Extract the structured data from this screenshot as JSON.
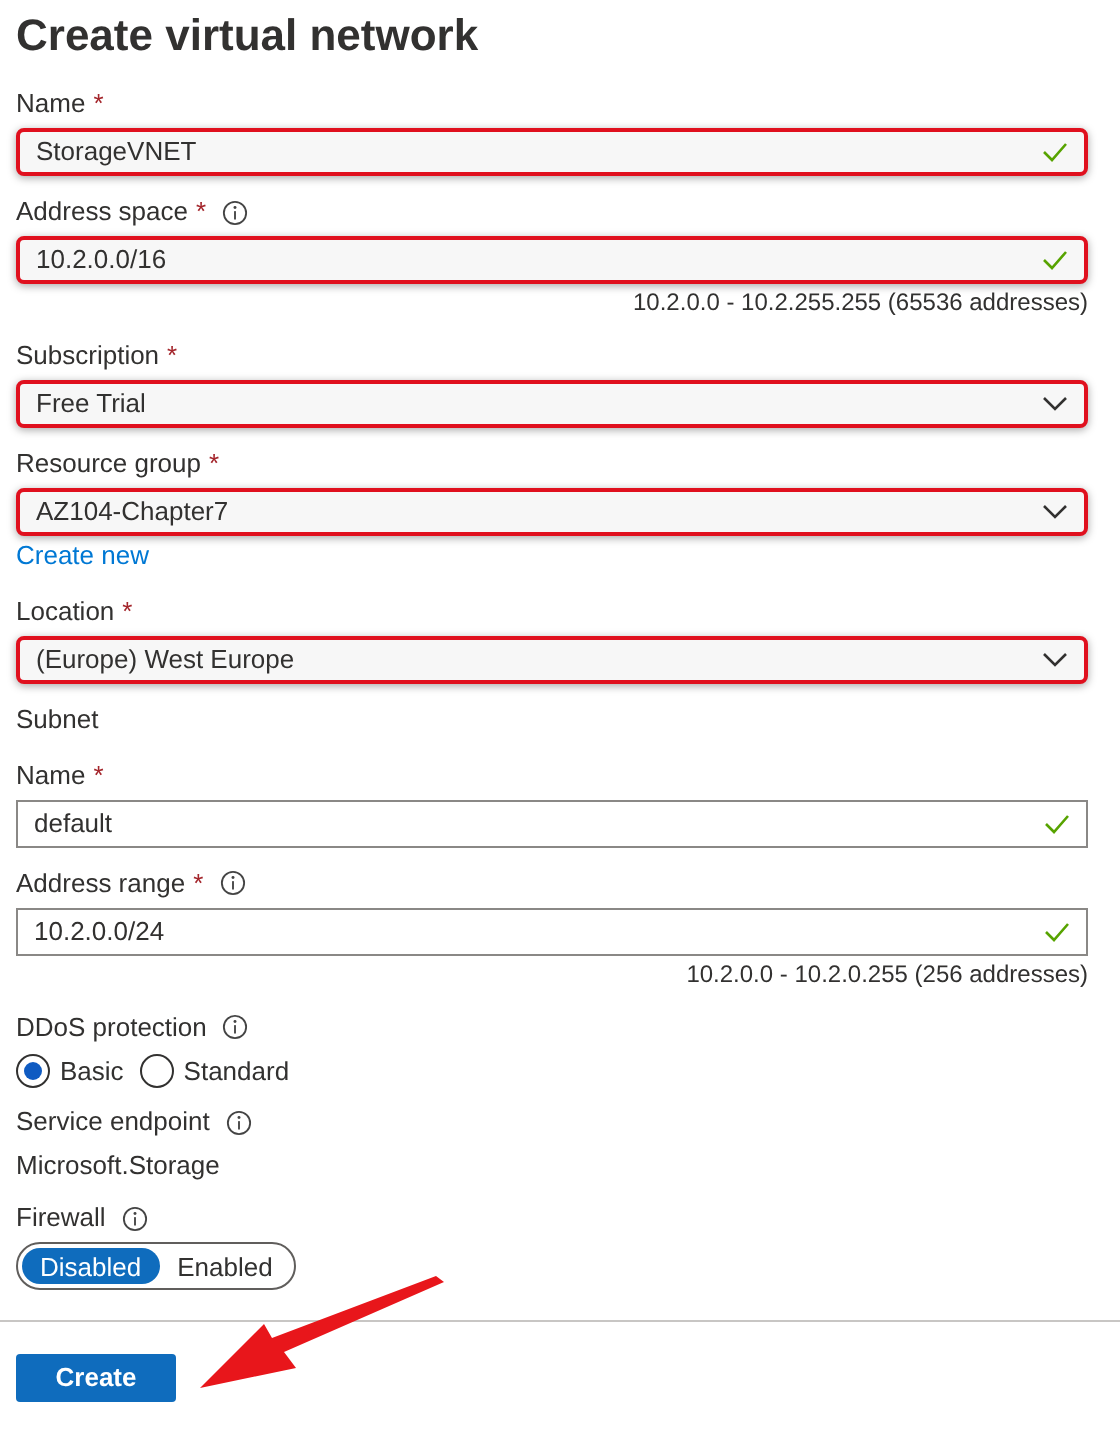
{
  "title": "Create virtual network",
  "form": [
    {
      "kind": "field",
      "label": "Name",
      "asterisk": "*",
      "value": "StorageVNET",
      "highlighted": true,
      "valid": true
    },
    {
      "kind": "field",
      "label": "Address space",
      "asterisk": "*",
      "info": true,
      "value": "10.2.0.0/16",
      "highlighted": true,
      "valid": true,
      "hint": "10.2.0.0 - 10.2.255.255 (65536 addresses)"
    },
    {
      "kind": "select",
      "label": "Subscription",
      "asterisk": "*",
      "value": "Free Trial",
      "highlighted": true
    },
    {
      "kind": "select",
      "label": "Resource group",
      "asterisk": "*",
      "value": "AZ104-Chapter7",
      "highlighted": true,
      "link": "Create new"
    },
    {
      "kind": "select",
      "label": "Location",
      "asterisk": "*",
      "value": "(Europe) West Europe",
      "highlighted": true
    },
    {
      "kind": "heading",
      "label": "Subnet"
    },
    {
      "kind": "field",
      "label": "Name",
      "asterisk": "*",
      "value": "default",
      "highlighted": false,
      "valid": true
    },
    {
      "kind": "field",
      "label": "Address range",
      "asterisk": "*",
      "info": true,
      "value": "10.2.0.0/24",
      "highlighted": false,
      "valid": true,
      "hint": "10.2.0.0 - 10.2.0.255 (256 addresses)"
    },
    {
      "kind": "radio",
      "label": "DDoS protection",
      "info": true,
      "options": [
        {
          "label": "Basic",
          "selected": true
        },
        {
          "label": "Standard",
          "selected": false
        }
      ]
    },
    {
      "kind": "static",
      "label": "Service endpoint",
      "info": true,
      "value": "Microsoft.Storage"
    },
    {
      "kind": "toggle",
      "label": "Firewall",
      "info": true,
      "options": [
        {
          "label": "Disabled",
          "selected": true
        },
        {
          "label": "Enabled",
          "selected": false
        }
      ]
    }
  ],
  "create_button": "Create"
}
